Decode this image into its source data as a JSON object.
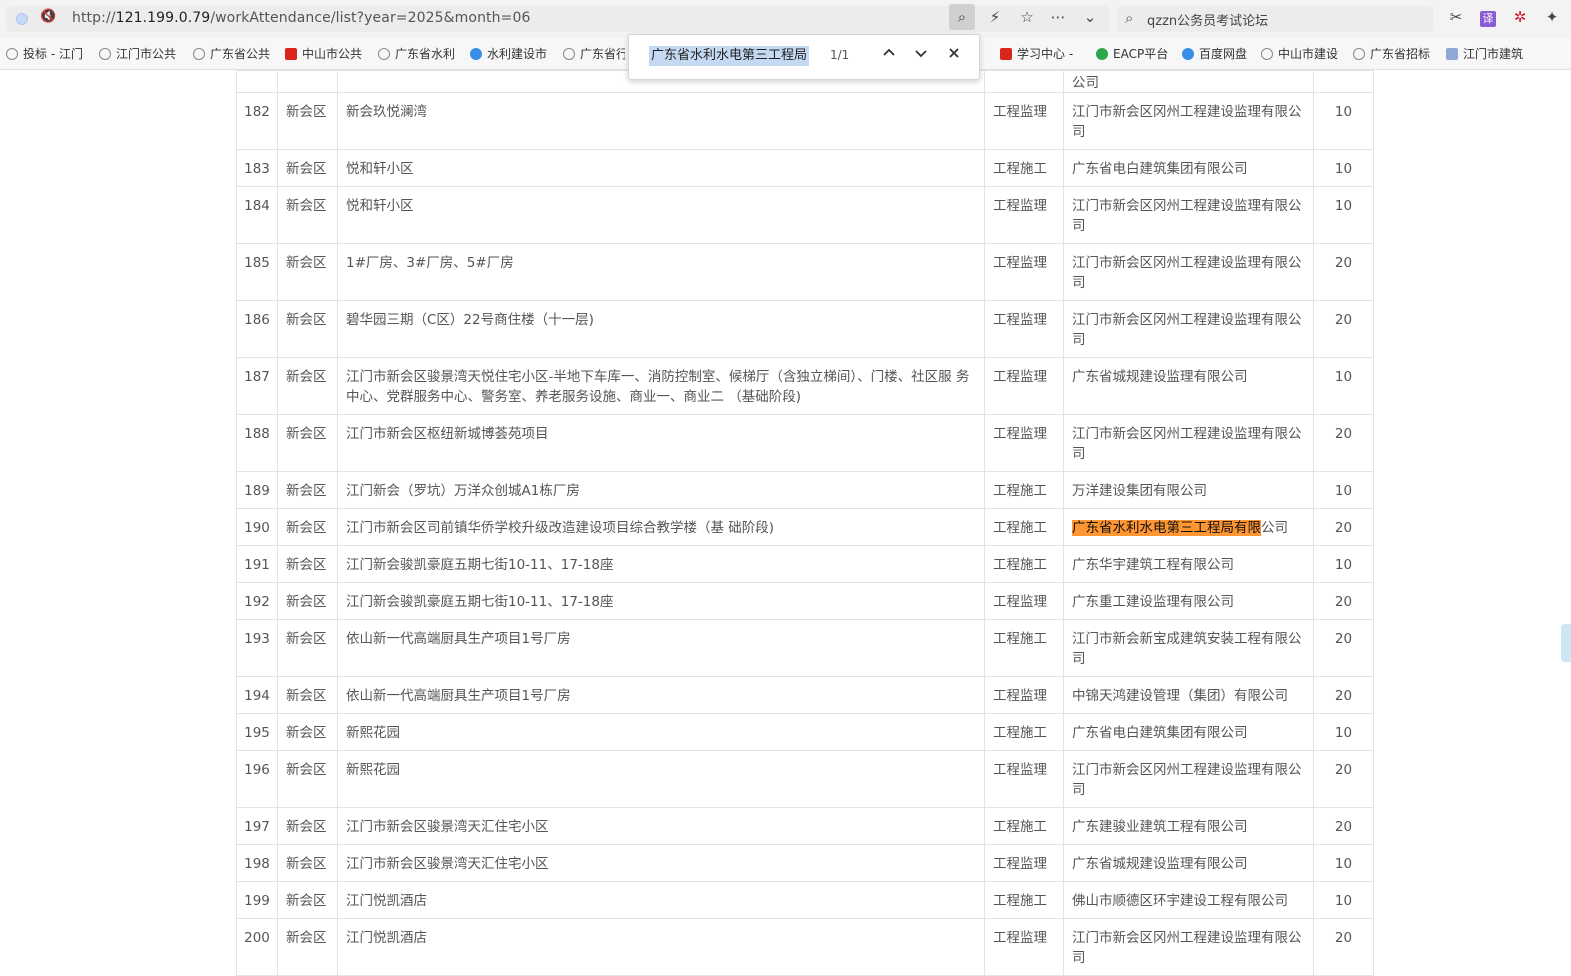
{
  "browser": {
    "url_prefix": "http://",
    "url_host": "121.199.0.79",
    "url_path": "/workAttendance/list?year=2025&month=06",
    "search_text": "qzzn公务员考试论坛"
  },
  "bookmarks": [
    "投标 - 江门",
    "江门市公共",
    "广东省公共",
    "中山市公共",
    "广东省水利",
    "水利建设市",
    "广东省行",
    "学习中心 -",
    "EACP平台",
    "百度网盘",
    "中山市建设",
    "广东省招标",
    "江门市建筑"
  ],
  "find": {
    "query": "广东省水利水电第三工程局",
    "count": "1/1"
  },
  "table": {
    "partial_row": {
      "company": "公司"
    },
    "rows": [
      {
        "no": "182",
        "district": "新会区",
        "project": "新会玖悦澜湾",
        "type": "工程监理",
        "company": "江门市新会区冈州工程建设监理有限公司",
        "score": "10"
      },
      {
        "no": "183",
        "district": "新会区",
        "project": "悦和轩小区",
        "type": "工程施工",
        "company": "广东省电白建筑集团有限公司",
        "score": "10"
      },
      {
        "no": "184",
        "district": "新会区",
        "project": "悦和轩小区",
        "type": "工程监理",
        "company": "江门市新会区冈州工程建设监理有限公司",
        "score": "10"
      },
      {
        "no": "185",
        "district": "新会区",
        "project": "1#厂房、3#厂房、5#厂房",
        "type": "工程监理",
        "company": "江门市新会区冈州工程建设监理有限公司",
        "score": "20"
      },
      {
        "no": "186",
        "district": "新会区",
        "project": "碧华园三期（C区）22号商住楼（十一层)",
        "type": "工程监理",
        "company": "江门市新会区冈州工程建设监理有限公司",
        "score": "20"
      },
      {
        "no": "187",
        "district": "新会区",
        "project": "江门市新会区骏景湾天悦住宅小区-半地下车库一、消防控制室、候梯厅（含独立梯间）、门楼、社区服 务中心、党群服务中心、警务室、养老服务设施、商业一、商业二 （基础阶段)",
        "type": "工程监理",
        "company": "广东省城规建设监理有限公司",
        "score": "10"
      },
      {
        "no": "188",
        "district": "新会区",
        "project": "江门市新会区枢纽新城博荟苑项目",
        "type": "工程监理",
        "company": "江门市新会区冈州工程建设监理有限公司",
        "score": "20"
      },
      {
        "no": "189",
        "district": "新会区",
        "project": "江门新会（罗坑）万洋众创城A1栋厂房",
        "type": "工程施工",
        "company": "万洋建设集团有限公司",
        "score": "10"
      },
      {
        "no": "190",
        "district": "新会区",
        "project": "江门市新会区司前镇华侨学校升级改造建设项目综合教学楼（基 础阶段)",
        "type": "工程施工",
        "company_hl": "广东省水利水电第三工程局有限",
        "company_rest": "公司",
        "score": "20"
      },
      {
        "no": "191",
        "district": "新会区",
        "project": "江门新会骏凯豪庭五期七街10-11、17-18座",
        "type": "工程施工",
        "company": "广东华宇建筑工程有限公司",
        "score": "10"
      },
      {
        "no": "192",
        "district": "新会区",
        "project": "江门新会骏凯豪庭五期七街10-11、17-18座",
        "type": "工程监理",
        "company": "广东重工建设监理有限公司",
        "score": "20"
      },
      {
        "no": "193",
        "district": "新会区",
        "project": "依山新一代高端厨具生产项目1号厂房",
        "type": "工程施工",
        "company": "江门市新会新宝成建筑安装工程有限公司",
        "score": "20"
      },
      {
        "no": "194",
        "district": "新会区",
        "project": "依山新一代高端厨具生产项目1号厂房",
        "type": "工程监理",
        "company": "中锦天鸿建设管理（集团）有限公司",
        "score": "20"
      },
      {
        "no": "195",
        "district": "新会区",
        "project": "新熙花园",
        "type": "工程施工",
        "company": "广东省电白建筑集团有限公司",
        "score": "10"
      },
      {
        "no": "196",
        "district": "新会区",
        "project": "新熙花园",
        "type": "工程监理",
        "company": "江门市新会区冈州工程建设监理有限公司",
        "score": "20"
      },
      {
        "no": "197",
        "district": "新会区",
        "project": "江门市新会区骏景湾天汇住宅小区",
        "type": "工程施工",
        "company": "广东建骏业建筑工程有限公司",
        "score": "20"
      },
      {
        "no": "198",
        "district": "新会区",
        "project": "江门市新会区骏景湾天汇住宅小区",
        "type": "工程监理",
        "company": "广东省城规建设监理有限公司",
        "score": "10"
      },
      {
        "no": "199",
        "district": "新会区",
        "project": "江门悦凯酒店",
        "type": "工程施工",
        "company": "佛山市顺德区环宇建设工程有限公司",
        "score": "10"
      },
      {
        "no": "200",
        "district": "新会区",
        "project": "江门悦凯酒店",
        "type": "工程监理",
        "company": "江门市新会区冈州工程建设监理有限公司",
        "score": "20"
      }
    ]
  }
}
